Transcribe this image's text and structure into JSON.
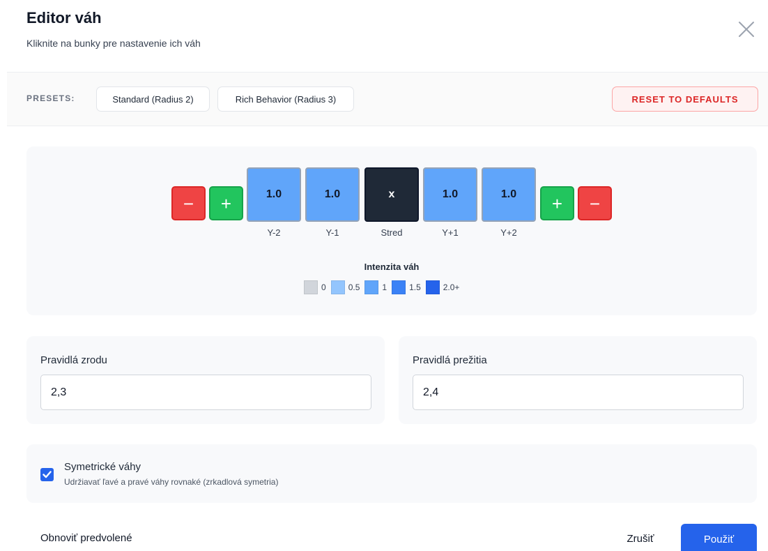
{
  "dialog": {
    "title": "Editor váh",
    "subtitle": "Kliknite na bunky pre nastavenie ich váh"
  },
  "presets": {
    "label": "PRESETS:",
    "items": [
      {
        "label": "Standard (Radius 2)"
      },
      {
        "label": "Rich Behavior (Radius 3)"
      }
    ],
    "reset_label": "RESET TO DEFAULTS"
  },
  "weights": {
    "controls": {
      "minus": "−",
      "plus": "+"
    },
    "cells": [
      {
        "value": "1.0",
        "label": "Y-2"
      },
      {
        "value": "1.0",
        "label": "Y-1"
      },
      {
        "value": "x",
        "label": "Stred"
      },
      {
        "value": "1.0",
        "label": "Y+1"
      },
      {
        "value": "1.0",
        "label": "Y+2"
      }
    ],
    "legend": {
      "title": "Intenzita váh",
      "items": [
        {
          "label": "0",
          "color": "#d1d5db"
        },
        {
          "label": "0.5",
          "color": "#93c5fd"
        },
        {
          "label": "1",
          "color": "#60a5fa"
        },
        {
          "label": "1.5",
          "color": "#3b82f6"
        },
        {
          "label": "2.0+",
          "color": "#2563eb"
        }
      ]
    }
  },
  "rules": {
    "birth": {
      "label": "Pravidlá zrodu",
      "value": "2,3"
    },
    "survival": {
      "label": "Pravidlá prežitia",
      "value": "2,4"
    }
  },
  "symmetry": {
    "checked": true,
    "title": "Symetrické váhy",
    "description": "Udržiavať ľavé a pravé váhy rovnaké (zrkadlová symetria)"
  },
  "footer": {
    "restore_label": "Obnoviť predvolené",
    "cancel_label": "Zrušiť",
    "apply_label": "Použiť"
  },
  "colors": {
    "accent": "#2563eb",
    "danger": "#ef4444",
    "success": "#22c55e",
    "center_cell": "#1f2937"
  }
}
